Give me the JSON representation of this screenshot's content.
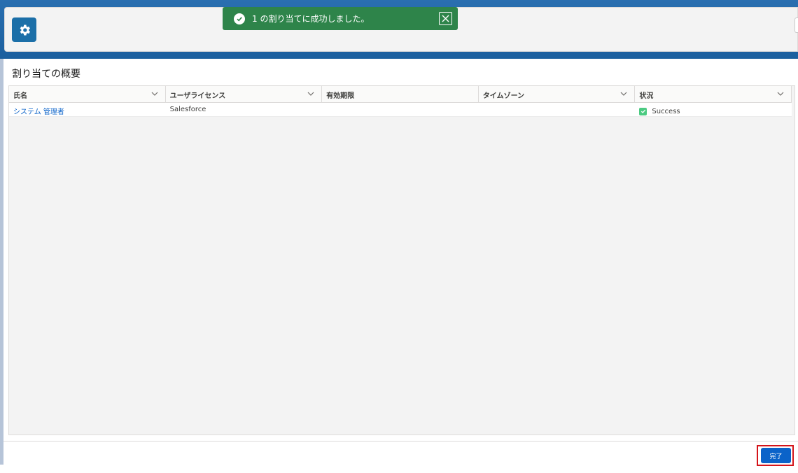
{
  "toast": {
    "message": "1 の割り当てに成功しました。"
  },
  "section": {
    "title": "割り当ての概要"
  },
  "table": {
    "columns": [
      {
        "label": "氏名",
        "sortable": true
      },
      {
        "label": "ユーザライセンス",
        "sortable": true
      },
      {
        "label": "有効期限",
        "sortable": false
      },
      {
        "label": "タイムゾーン",
        "sortable": true
      },
      {
        "label": "状況",
        "sortable": true
      }
    ],
    "rows": [
      {
        "name": "システム 管理者",
        "license": "Salesforce",
        "expiration": "",
        "timezone": "",
        "status": "Success"
      }
    ]
  },
  "footer": {
    "done_label": "完了"
  },
  "colors": {
    "brand_blue": "#0b63c9",
    "toast_green": "#2e844a",
    "success_green": "#4bca81",
    "highlight_red": "#d4141a"
  }
}
